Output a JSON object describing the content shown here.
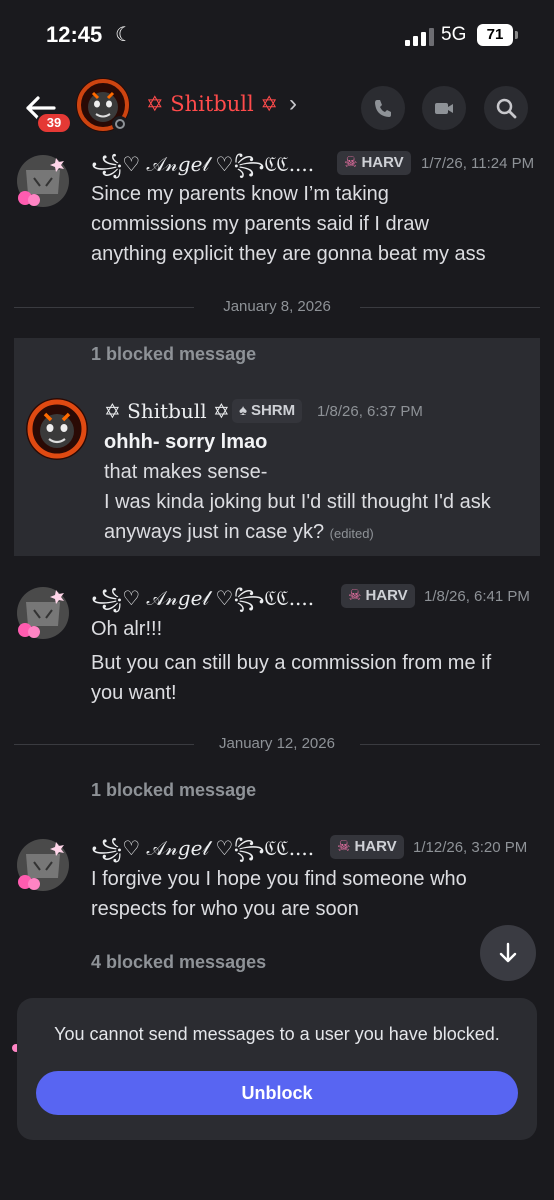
{
  "status_bar": {
    "time": "12:45",
    "network": "5G",
    "battery": "71"
  },
  "header": {
    "unread_count": "39",
    "channel_name": "✡ Shitbull ✡",
    "chevron": "›"
  },
  "colors": {
    "accent": "#5865f2",
    "name_red": "#ff4b4b",
    "badge_red": "#e53935",
    "background": "#1a1a1e",
    "panel": "#2b2c31"
  },
  "messages": [
    {
      "author": "꧁♡ 𝒜𝓃𝑔𝑒𝓁 ♡꧂ℭℭ....",
      "tag": "HARV",
      "timestamp": "1/7/26, 11:24 PM",
      "lines": [
        "Since my parents know I’m taking",
        "commissions my parents said if I draw",
        "anything explicit they are gonna beat my ass"
      ]
    },
    {
      "author": "✡ Shitbull ✡",
      "tag": "SHRM",
      "timestamp": "1/8/26, 6:37 PM",
      "bold_line": "ohhh- sorry lmao",
      "lines": [
        "that makes sense-",
        "I was kinda joking but I'd still thought I'd ask",
        "anyways just in case yk?"
      ],
      "edited": "(edited)"
    },
    {
      "author": "꧁♡ 𝒜𝓃𝑔𝑒𝓁 ♡꧂ℭℭ....",
      "tag": "HARV",
      "timestamp": "1/8/26, 6:41 PM",
      "line1": "Oh alr!!!",
      "lines": [
        "But you can still buy a commission from me if",
        "you want!"
      ]
    },
    {
      "author": "꧁♡ 𝒜𝓃𝑔𝑒𝓁 ♡꧂ℭℭ....",
      "tag": "HARV",
      "timestamp": "1/12/26, 3:20 PM",
      "lines": [
        "I forgive you I hope you find someone who",
        "respects for who you are soon"
      ]
    }
  ],
  "separators": [
    "January 8, 2026",
    "January 12, 2026"
  ],
  "blocked": {
    "one": "1 blocked message",
    "four": "4 blocked messages"
  },
  "footer": {
    "notice": "You cannot send messages to a user you have blocked.",
    "unblock_label": "Unblock"
  }
}
